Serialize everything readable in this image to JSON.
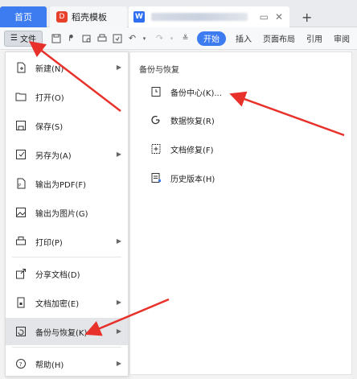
{
  "tabs": {
    "home": "首页",
    "template": "稻壳模板",
    "template_logo": "D",
    "doc_logo": "W"
  },
  "toolbar": {
    "file_label": "文件",
    "start_label": "开始",
    "ribbon_tabs": [
      "插入",
      "页面布局",
      "引用",
      "审阅"
    ]
  },
  "menu": {
    "items": [
      {
        "label": "新建(N)",
        "icon": "new-doc-icon",
        "has_submenu": true
      },
      {
        "label": "打开(O)",
        "icon": "folder-icon",
        "has_submenu": false
      },
      {
        "label": "保存(S)",
        "icon": "save-icon",
        "has_submenu": false
      },
      {
        "label": "另存为(A)",
        "icon": "save-as-icon",
        "has_submenu": true
      },
      {
        "label": "输出为PDF(F)",
        "icon": "pdf-icon",
        "has_submenu": false
      },
      {
        "label": "输出为图片(G)",
        "icon": "image-icon",
        "has_submenu": false
      },
      {
        "label": "打印(P)",
        "icon": "print-icon",
        "has_submenu": true
      },
      {
        "label": "分享文档(D)",
        "icon": "share-icon",
        "has_submenu": false
      },
      {
        "label": "文档加密(E)",
        "icon": "lock-doc-icon",
        "has_submenu": true
      },
      {
        "label": "备份与恢复(K)",
        "icon": "backup-icon",
        "has_submenu": true,
        "active": true
      },
      {
        "label": "帮助(H)",
        "icon": "help-icon",
        "has_submenu": true
      }
    ]
  },
  "submenu": {
    "title": "备份与恢复",
    "items": [
      {
        "label": "备份中心(K)...",
        "icon": "backup-center-icon"
      },
      {
        "label": "数据恢复(R)",
        "icon": "data-recovery-icon"
      },
      {
        "label": "文档修复(F)",
        "icon": "doc-repair-icon"
      },
      {
        "label": "历史版本(H)",
        "icon": "history-version-icon"
      }
    ]
  },
  "colors": {
    "accent": "#3c7bf0",
    "annotation_arrow": "#e8312a",
    "active_item_bg": "#e3e5e8"
  }
}
